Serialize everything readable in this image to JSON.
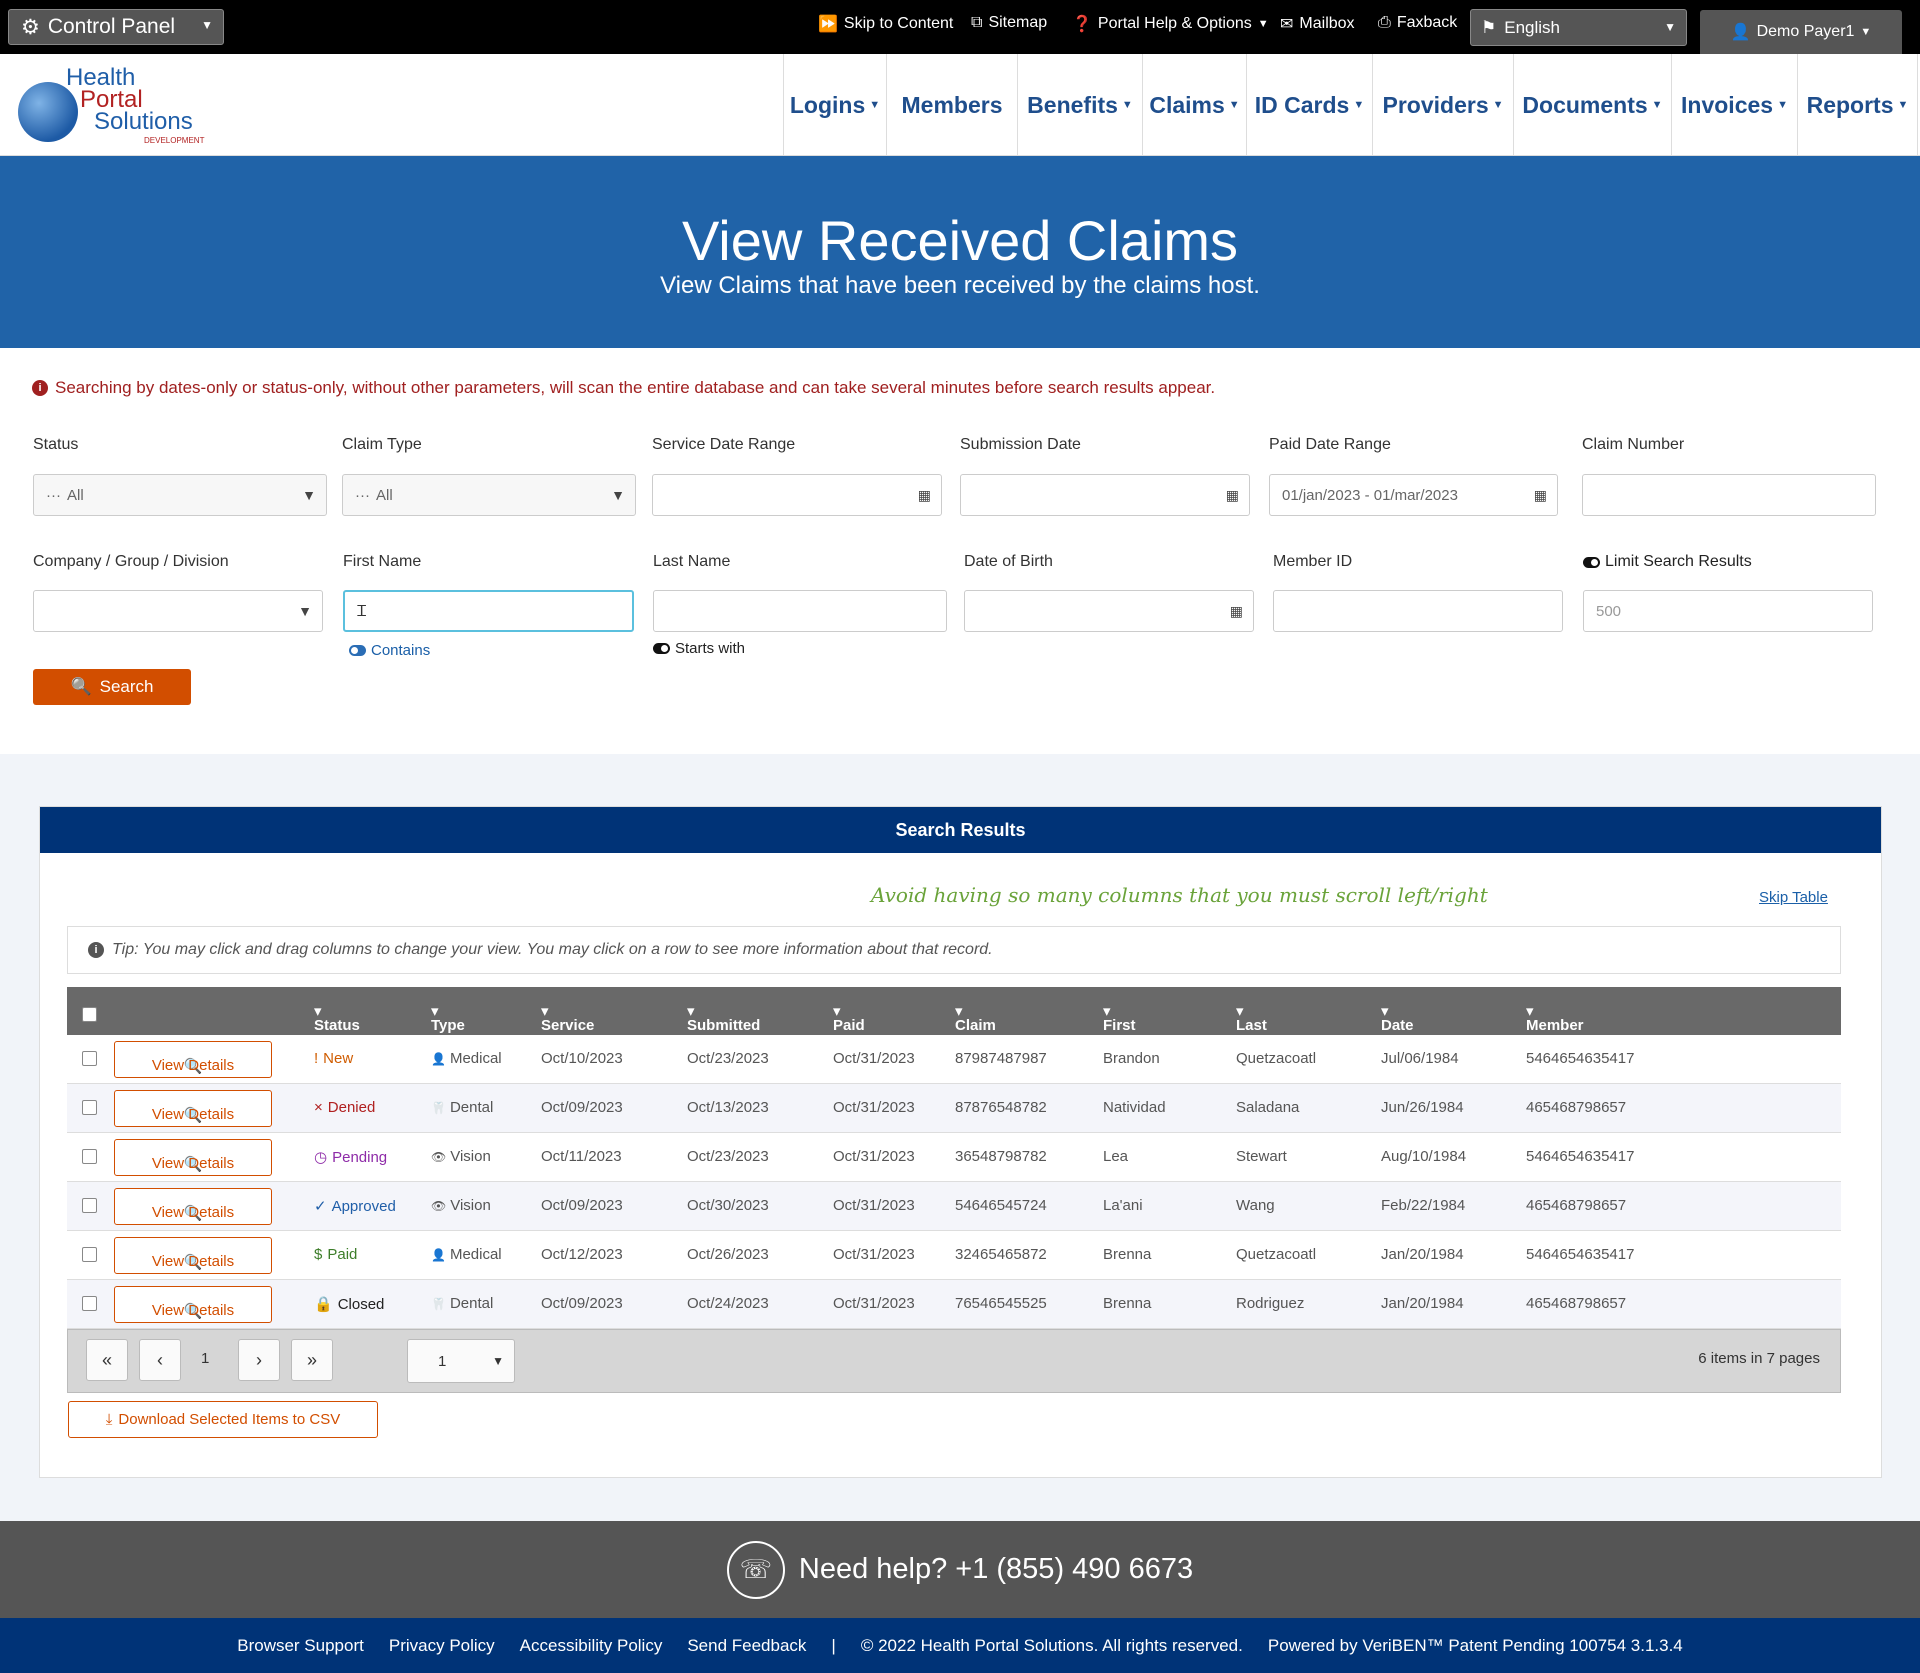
{
  "topbar": {
    "control_panel": "Control Panel",
    "skip": "Skip to Content",
    "sitemap": "Sitemap",
    "help": "Portal Help & Options",
    "mailbox": "Mailbox",
    "faxback": "Faxback",
    "language": "English",
    "user": "Demo Payer1"
  },
  "logo": {
    "line1": "Health",
    "line2": "Portal",
    "line3": "Solutions",
    "line4": "DEVELOPMENT"
  },
  "nav": [
    "Logins",
    "Members",
    "Benefits",
    "Claims",
    "ID Cards",
    "Providers",
    "Documents",
    "Invoices",
    "Reports"
  ],
  "banner": {
    "title": "View Received Claims",
    "subtitle": "View Claims that have been received by the claims host."
  },
  "form": {
    "warning": "Searching by dates-only or status-only, without other parameters, will scan the entire database and can take several minutes before search results appear.",
    "status_label": "Status",
    "status_value": "All",
    "claimtype_label": "Claim Type",
    "claimtype_value": "All",
    "service_label": "Service Date Range",
    "submission_label": "Submission Date",
    "paid_label": "Paid Date Range",
    "paid_value": "01/jan/2023 - 01/mar/2023",
    "claimnum_label": "Claim Number",
    "company_label": "Company / Group / Division",
    "first_label": "First Name",
    "first_hint": "Contains",
    "last_label": "Last Name",
    "last_hint": "Starts with",
    "dob_label": "Date of Birth",
    "member_label": "Member ID",
    "limit_label": "Limit Search Results",
    "limit_placeholder": "500",
    "search_button": "Search"
  },
  "results": {
    "header": "Search Results",
    "avoid": "Avoid having so many columns that you must scroll left/right",
    "skip": "Skip Table",
    "tip": "Tip: You may click and drag columns to change your view. You may click on a row to see more information about that record.",
    "columns": [
      "Status",
      "Type",
      "Service Date",
      "Submitted Date",
      "Paid Date",
      "Claim Number",
      "First Name",
      "Last Name",
      "Date of Birth",
      "Member ID"
    ],
    "view_details": "View Details",
    "rows": [
      {
        "status": "New",
        "status_color": "#d05c00",
        "status_icon": "!",
        "type": "Medical",
        "service": "Oct/10/2023",
        "submitted": "Oct/23/2023",
        "paid": "Oct/31/2023",
        "claim": "87987487987",
        "first": "Brandon",
        "last": "Quetzacoatl",
        "dob": "Jul/06/1984",
        "member": "5464654635417"
      },
      {
        "status": "Denied",
        "status_color": "#b02020",
        "status_icon": "×",
        "type": "Dental",
        "service": "Oct/09/2023",
        "submitted": "Oct/13/2023",
        "paid": "Oct/31/2023",
        "claim": "87876548782",
        "first": "Natividad",
        "last": "Saladana",
        "dob": "Jun/26/1984",
        "member": "465468798657"
      },
      {
        "status": "Pending",
        "status_color": "#8e2ba8",
        "status_icon": "◷",
        "type": "Vision",
        "service": "Oct/11/2023",
        "submitted": "Oct/23/2023",
        "paid": "Oct/31/2023",
        "claim": "36548798782",
        "first": "Lea",
        "last": "Stewart",
        "dob": "Aug/10/1984",
        "member": "5464654635417"
      },
      {
        "status": "Approved",
        "status_color": "#1f5ea8",
        "status_icon": "✓",
        "type": "Vision",
        "service": "Oct/09/2023",
        "submitted": "Oct/30/2023",
        "paid": "Oct/31/2023",
        "claim": "54646545724",
        "first": "La'ani",
        "last": "Wang",
        "dob": "Feb/22/1984",
        "member": "465468798657"
      },
      {
        "status": "Paid",
        "status_color": "#3d7d2a",
        "status_icon": "$",
        "type": "Medical",
        "service": "Oct/12/2023",
        "submitted": "Oct/26/2023",
        "paid": "Oct/31/2023",
        "claim": "32465465872",
        "first": "Brenna",
        "last": "Quetzacoatl",
        "dob": "Jan/20/1984",
        "member": "5464654635417"
      },
      {
        "status": "Closed",
        "status_color": "#222222",
        "status_icon": "🔒",
        "type": "Dental",
        "service": "Oct/09/2023",
        "submitted": "Oct/24/2023",
        "paid": "Oct/31/2023",
        "claim": "76546545525",
        "first": "Brenna",
        "last": "Rodriguez",
        "dob": "Jan/20/1984",
        "member": "465468798657"
      }
    ],
    "page_number": "1",
    "page_select": "1",
    "page_info": "6 items in 7 pages",
    "csv": "Download Selected Items to CSV"
  },
  "footer": {
    "help": "Need help? +1 (855) 490 6673",
    "links": [
      "Browser Support",
      "Privacy Policy",
      "Accessibility Policy",
      "Send Feedback"
    ],
    "separator": "|",
    "copyright": "© 2022 Health Portal Solutions. All rights reserved.",
    "powered": "Powered by VeriBEN™ Patent Pending 100754 3.1.3.4"
  }
}
